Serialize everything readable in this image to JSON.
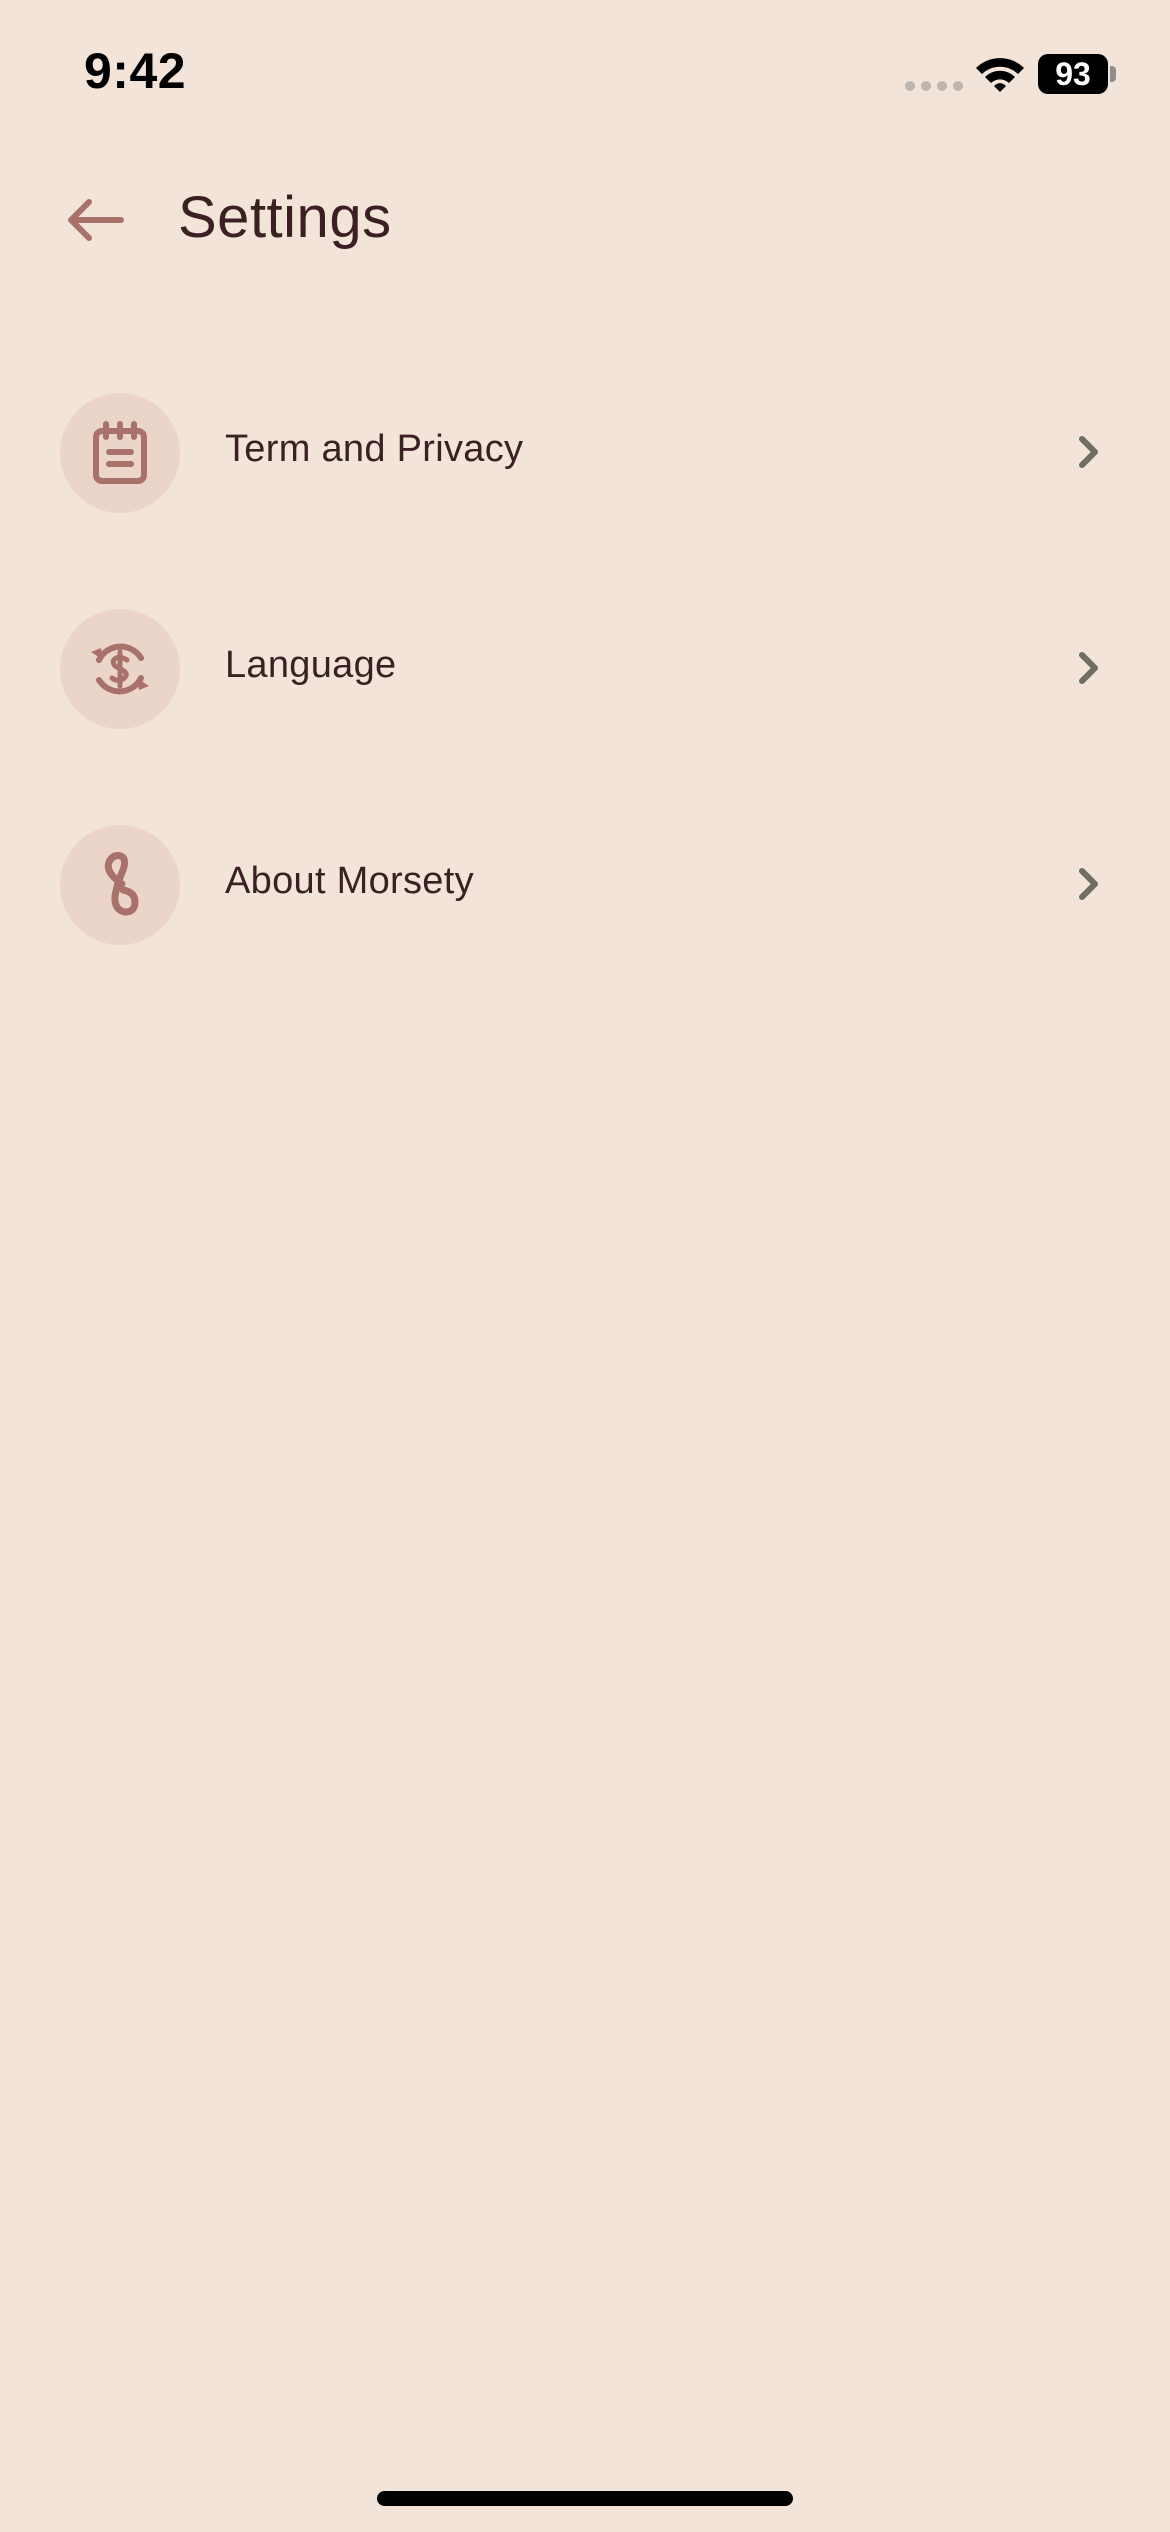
{
  "status_bar": {
    "time": "9:42",
    "battery": "93"
  },
  "header": {
    "back_icon": "arrow-left-icon",
    "title": "Settings"
  },
  "settings": {
    "items": [
      {
        "label": "Term and Privacy",
        "icon": "notepad-icon"
      },
      {
        "label": "Language",
        "icon": "currency-exchange-icon"
      },
      {
        "label": "About Morsety",
        "icon": "morsety-logo-icon"
      }
    ],
    "chevron_icon": "chevron-right-icon"
  },
  "colors": {
    "background": "#F3E4DA",
    "icon_circle": "#EBD5C8",
    "accent": "#A8716A",
    "text": "#3A1F23",
    "chevron": "#6E6E62"
  }
}
